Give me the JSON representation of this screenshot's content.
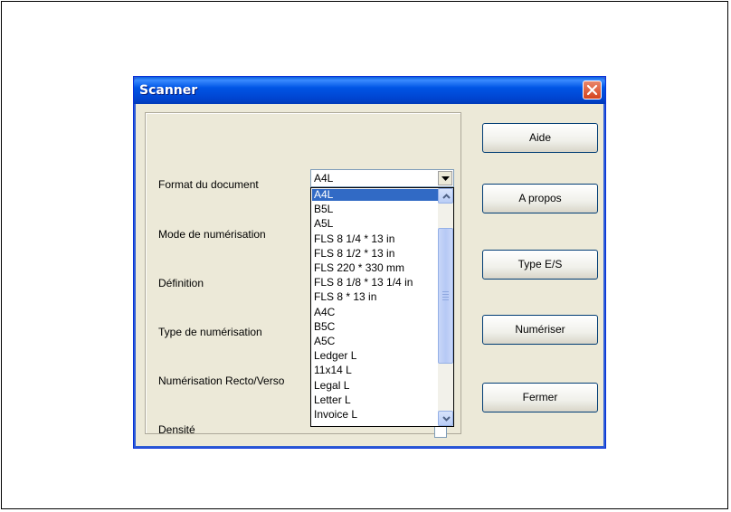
{
  "window": {
    "title": "Scanner"
  },
  "form": {
    "format_label": "Format du document",
    "mode_label": "Mode de numérisation",
    "definition_label": "Définition",
    "type_label": "Type de numérisation",
    "recto_verso_label": "Numérisation Recto/Verso",
    "densite_label": "Densité",
    "format_value": "A4L"
  },
  "format_options": [
    "A4L",
    "B5L",
    "A5L",
    "FLS 8 1/4 * 13 in",
    "FLS 8 1/2 * 13 in",
    "FLS 220 * 330 mm",
    "FLS 8 1/8 * 13 1/4 in",
    "FLS 8 * 13 in",
    "A4C",
    "B5C",
    "A5C",
    "Ledger L",
    "11x14 L",
    "Legal L",
    "Letter L",
    "Invoice L"
  ],
  "selected_option": "A4L",
  "buttons": {
    "aide": "Aide",
    "a_propos": "A propos",
    "type_es": "Type E/S",
    "numeriser": "Numériser",
    "fermer": "Fermer"
  },
  "colors": {
    "titlebar": "#0054e3",
    "selection": "#316ac5",
    "dialog_bg": "#ece9d8",
    "close_button": "#d5431d"
  }
}
